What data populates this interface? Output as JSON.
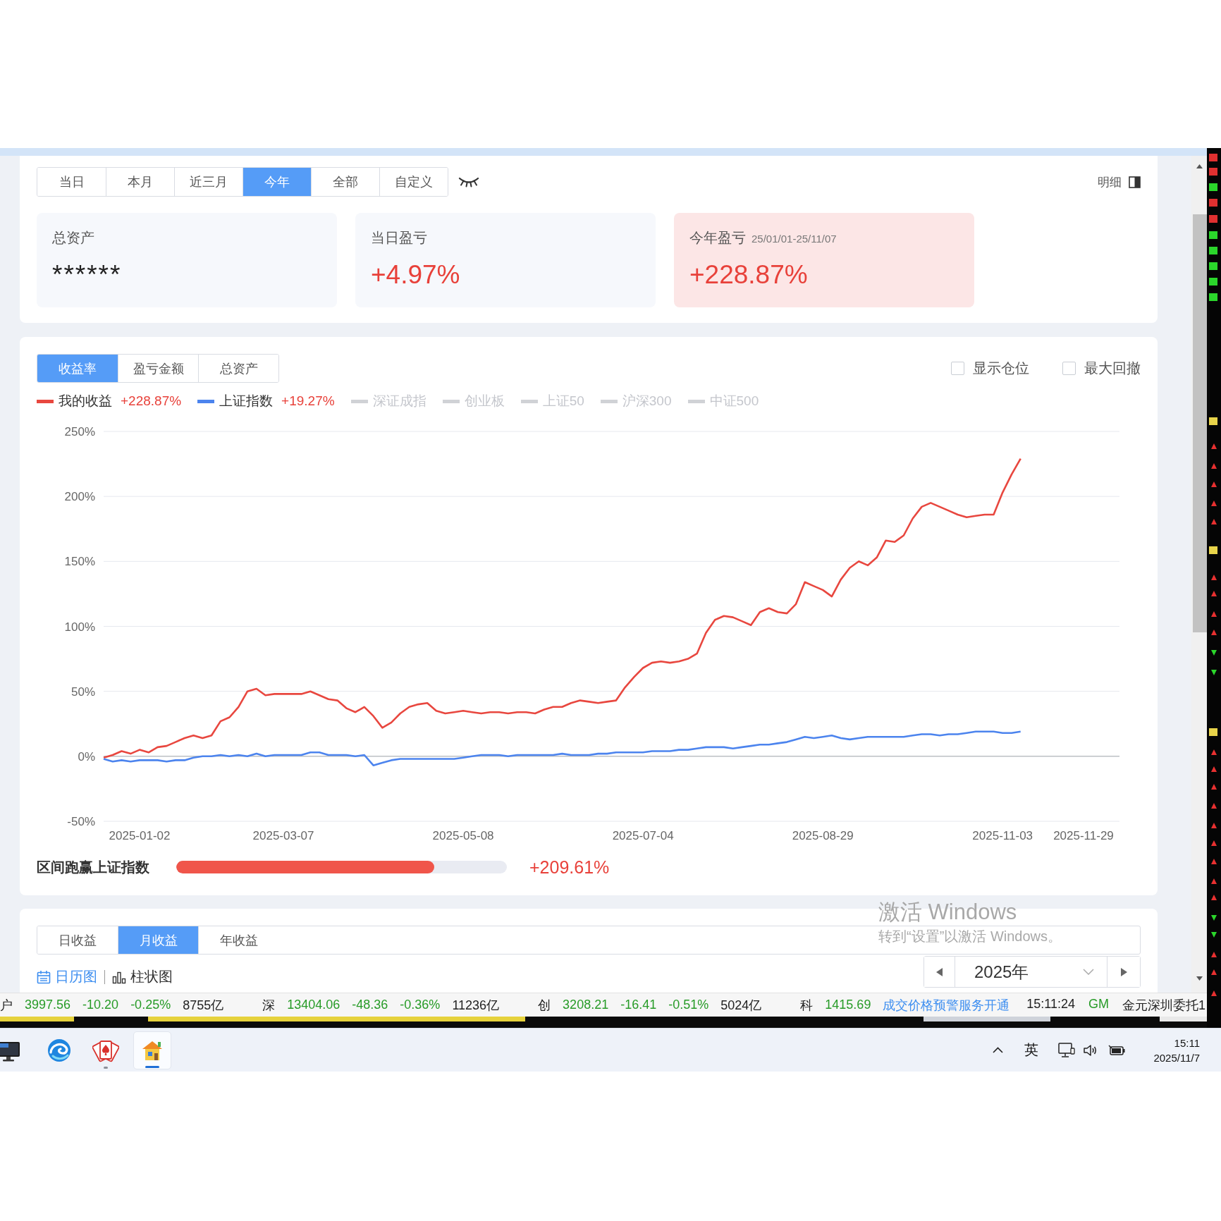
{
  "period_tabs": [
    {
      "label": "当日",
      "selected": false
    },
    {
      "label": "本月",
      "selected": false
    },
    {
      "label": "近三月",
      "selected": false
    },
    {
      "label": "今年",
      "selected": true
    },
    {
      "label": "全部",
      "selected": false
    },
    {
      "label": "自定义",
      "selected": false
    }
  ],
  "details_button": {
    "label": "明细"
  },
  "summary_cards": [
    {
      "label": "总资产",
      "value": "******",
      "kind": "masked",
      "highlighted": false
    },
    {
      "label": "当日盈亏",
      "value": "+4.97%",
      "kind": "gain",
      "highlighted": false
    },
    {
      "label": "今年盈亏",
      "range": "25/01/01-25/11/07",
      "value": "+228.87%",
      "kind": "gain",
      "highlighted": true
    }
  ],
  "performance": {
    "metric_tabs": [
      {
        "label": "收益率",
        "selected": true
      },
      {
        "label": "盈亏金额",
        "selected": false
      },
      {
        "label": "总资产",
        "selected": false
      }
    ],
    "options": [
      {
        "label": "显示仓位",
        "checked": false
      },
      {
        "label": "最大回撤",
        "checked": false
      }
    ],
    "legend": [
      {
        "name": "我的收益",
        "value": "+228.87%",
        "color": "#e8473f",
        "enabled": true
      },
      {
        "name": "上证指数",
        "value": "+19.27%",
        "color": "#4c84ee",
        "enabled": true
      },
      {
        "name": "深证成指",
        "enabled": false
      },
      {
        "name": "创业板",
        "enabled": false
      },
      {
        "name": "上证50",
        "enabled": false
      },
      {
        "name": "沪深300",
        "enabled": false
      },
      {
        "name": "中证500",
        "enabled": false
      }
    ],
    "chart_data": {
      "type": "line",
      "grid": true,
      "categories": [
        null,
        null,
        null,
        null,
        "2025-01-02",
        null,
        null,
        null,
        null,
        null,
        null,
        null,
        null,
        null,
        null,
        null,
        null,
        null,
        null,
        null,
        "2025-03-07",
        null,
        null,
        null,
        null,
        null,
        null,
        null,
        null,
        null,
        null,
        null,
        null,
        null,
        null,
        null,
        null,
        null,
        null,
        null,
        "2025-05-08",
        null,
        null,
        null,
        null,
        null,
        null,
        null,
        null,
        null,
        null,
        null,
        null,
        null,
        null,
        null,
        null,
        null,
        null,
        null,
        "2025-07-04",
        null,
        null,
        null,
        null,
        null,
        null,
        null,
        null,
        null,
        null,
        null,
        null,
        null,
        null,
        null,
        null,
        null,
        null,
        null,
        "2025-08-29",
        null,
        null,
        null,
        null,
        null,
        null,
        null,
        null,
        null,
        null,
        null,
        null,
        null,
        null,
        null,
        null,
        null,
        null,
        null,
        "2025-11-03",
        null,
        null,
        null,
        null,
        null,
        null,
        null,
        null,
        "2025-11-29",
        null,
        null,
        null,
        null
      ],
      "ylim": [
        -50,
        250
      ],
      "yticks": [
        {
          "value": 250,
          "label": "250%"
        },
        {
          "value": 200,
          "label": "200%"
        },
        {
          "value": 150,
          "label": "150%"
        },
        {
          "value": 100,
          "label": "100%"
        },
        {
          "value": 50,
          "label": "50%"
        },
        {
          "value": 0,
          "label": "0%"
        },
        {
          "value": -50,
          "label": "-50%"
        }
      ],
      "series": [
        {
          "color": "#e8473f",
          "values": [
            -1,
            1,
            4,
            2,
            5,
            3,
            7,
            8,
            11,
            14,
            16,
            14,
            16,
            27,
            30,
            38,
            50,
            52,
            47,
            48,
            48,
            48,
            48,
            50,
            47,
            44,
            43,
            37,
            34,
            38,
            31,
            22,
            26,
            33,
            38,
            40,
            41,
            35,
            33,
            34,
            35,
            34,
            33,
            34,
            34,
            33,
            34,
            34,
            33,
            36,
            38,
            38,
            41,
            43,
            42,
            41,
            42,
            43,
            53,
            61,
            68,
            72,
            73,
            72,
            73,
            75,
            79,
            95,
            105,
            108,
            107,
            104,
            101,
            111,
            114,
            111,
            110,
            117,
            134,
            131,
            128,
            123,
            136,
            145,
            150,
            147,
            153,
            166,
            165,
            170,
            183,
            192,
            195,
            192,
            189,
            186,
            184,
            185,
            186,
            186,
            203,
            217,
            229,
            null,
            null,
            null,
            null,
            null,
            null,
            null,
            null,
            null,
            null,
            null
          ]
        },
        {
          "color": "#4c84ee",
          "values": [
            -2,
            -4,
            -3,
            -4,
            -3,
            -3,
            -3,
            -4,
            -3,
            -3,
            -1,
            0,
            0,
            1,
            0,
            1,
            0,
            2,
            0,
            1,
            1,
            1,
            1,
            3,
            3,
            1,
            1,
            1,
            0,
            1,
            -7,
            -5,
            -3,
            -2,
            -2,
            -2,
            -2,
            -2,
            -2,
            -2,
            -1,
            0,
            1,
            1,
            1,
            0,
            1,
            1,
            1,
            1,
            1,
            2,
            1,
            1,
            1,
            2,
            2,
            3,
            3,
            3,
            3,
            4,
            4,
            4,
            5,
            5,
            6,
            7,
            7,
            7,
            6,
            7,
            8,
            9,
            9,
            10,
            11,
            13,
            15,
            14,
            15,
            16,
            14,
            13,
            14,
            15,
            15,
            15,
            15,
            15,
            16,
            17,
            17,
            16,
            17,
            17,
            18,
            19,
            19,
            19,
            18,
            18,
            19,
            null,
            null,
            null,
            null,
            null,
            null,
            null,
            null,
            null,
            null,
            null
          ]
        }
      ]
    },
    "outperformance": {
      "label": "区间跑赢上证指数",
      "level": 0.78,
      "value": "+209.61%"
    }
  },
  "returns": {
    "tabs": [
      {
        "label": "日收益",
        "selected": false
      },
      {
        "label": "月收益",
        "selected": true
      },
      {
        "label": "年收益",
        "selected": false
      }
    ],
    "views": [
      {
        "kind": "calendar",
        "label": "日历图",
        "selected": true
      },
      {
        "kind": "bars",
        "label": "柱状图",
        "selected": false
      }
    ],
    "year": "2025年"
  },
  "activation_notice": {
    "title": "激活 Windows",
    "message": "转到“设置”以激活 Windows。"
  },
  "status_bar": {
    "quotes": [
      {
        "market": "户",
        "values": [
          {
            "text": "3997.56",
            "color": "#279b27"
          },
          {
            "text": "-10.20",
            "color": "#279b27"
          },
          {
            "text": "-0.25%",
            "color": "#279b27"
          },
          {
            "text": "8755亿",
            "color": "#222222"
          }
        ]
      },
      {
        "market": "深",
        "values": [
          {
            "text": "13404.06",
            "color": "#279b27"
          },
          {
            "text": "-48.36",
            "color": "#279b27"
          },
          {
            "text": "-0.36%",
            "color": "#279b27"
          },
          {
            "text": "11236亿",
            "color": "#222222"
          }
        ]
      },
      {
        "market": "创",
        "values": [
          {
            "text": "3208.21",
            "color": "#279b27"
          },
          {
            "text": "-16.41",
            "color": "#279b27"
          },
          {
            "text": "-0.51%",
            "color": "#279b27"
          },
          {
            "text": "5024亿",
            "color": "#222222"
          }
        ]
      },
      {
        "market": "科",
        "values": [
          {
            "text": "1415.69",
            "color": "#279b27"
          }
        ],
        "link": "成交价格预警服务开通"
      }
    ],
    "right": [
      {
        "text": "15:11:24",
        "color": "#222222"
      },
      {
        "text": "GM",
        "color": "#279b27"
      },
      {
        "text": "金元深圳委托1",
        "color": "#222222"
      }
    ]
  },
  "taskbar": {
    "apps": [
      {
        "kind": "monitor",
        "open": false,
        "active": false
      },
      {
        "kind": "swirl",
        "open": false,
        "active": false
      },
      {
        "kind": "cards",
        "open": true,
        "active": false
      },
      {
        "kind": "house",
        "open": true,
        "active": true
      }
    ],
    "tray": {
      "input_method": "英",
      "time": "15:11",
      "date": "2025/11/7"
    }
  }
}
